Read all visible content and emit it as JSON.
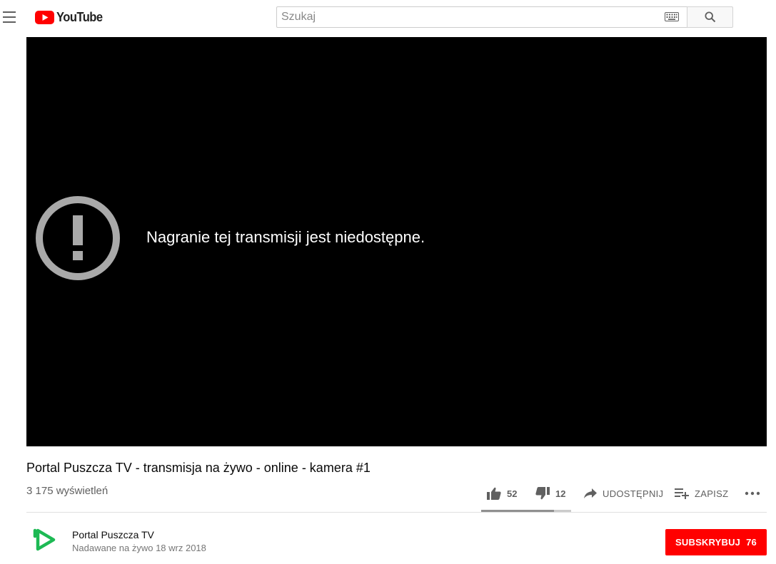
{
  "header": {
    "logo_text": "YouTube",
    "search_placeholder": "Szukaj",
    "search_value": ""
  },
  "player": {
    "error_message": "Nagranie tej transmisji jest niedostępne."
  },
  "video": {
    "title": "Portal Puszcza TV - transmisja na żywo - online - kamera #1",
    "views": "3 175 wyświetleń",
    "likes": "52",
    "dislikes": "12",
    "share_label": "UDOSTĘPNIJ",
    "save_label": "ZAPISZ",
    "like_ratio": 0.81
  },
  "channel": {
    "name": "Portal Puszcza TV",
    "published": "Nadawane na żywo 18 wrz 2018",
    "subscribe_label": "SUBSKRYBUJ",
    "subscriber_count": "76"
  },
  "colors": {
    "brand_red": "#ff0000",
    "logo_green": "#1db954"
  },
  "icons": [
    "menu-icon",
    "youtube-logo-icon",
    "keyboard-icon",
    "search-icon",
    "error-icon",
    "thumb-up-icon",
    "thumb-down-icon",
    "share-icon",
    "playlist-add-icon",
    "more-icon",
    "channel-avatar-icon"
  ]
}
